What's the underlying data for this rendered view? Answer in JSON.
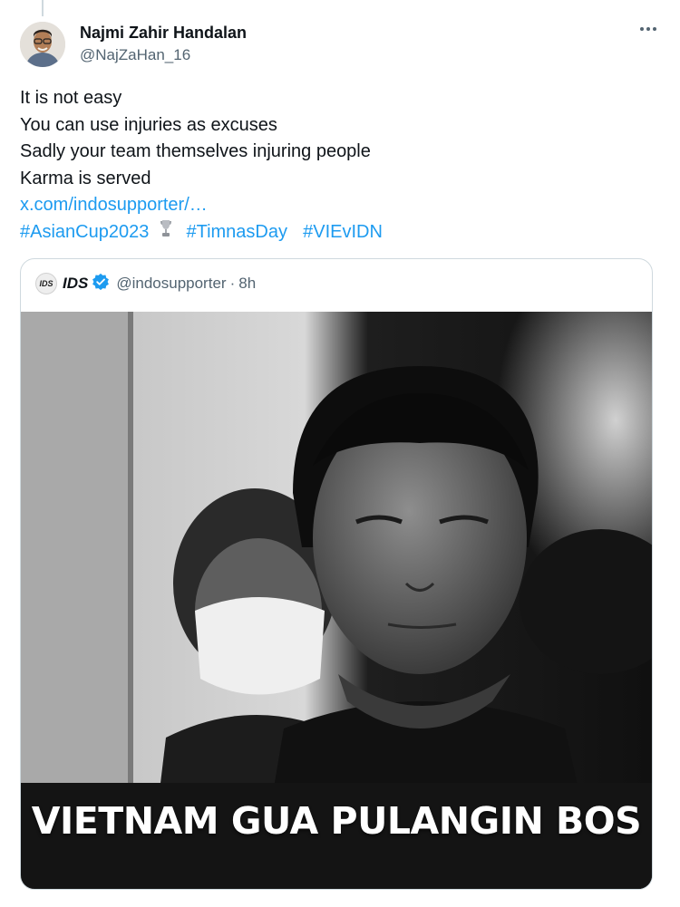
{
  "tweet": {
    "author": {
      "display_name": "Najmi Zahir Handalan",
      "handle": "@NajZaHan_16"
    },
    "text_lines": [
      "It is not easy",
      "You can use injuries as excuses",
      "Sadly your team themselves injuring people",
      "Karma is served"
    ],
    "link_text": "x.com/indosupporter/…",
    "hashtags": [
      "#AsianCup2023",
      "#TimnasDay",
      "#VIEvIDN"
    ],
    "more_icon": "more-horizontal-icon"
  },
  "quoted_tweet": {
    "logo_text": "IDS",
    "name": "IDS",
    "handle": "@indosupporter",
    "separator": "·",
    "time": "8h",
    "verified_color": "#1d9bf0",
    "media_caption": "VIETNAM GUA PULANGIN BOS"
  },
  "colors": {
    "link": "#1d9bf0",
    "secondary_text": "#536471",
    "primary_text": "#0f1419",
    "border": "#cfd9de"
  }
}
